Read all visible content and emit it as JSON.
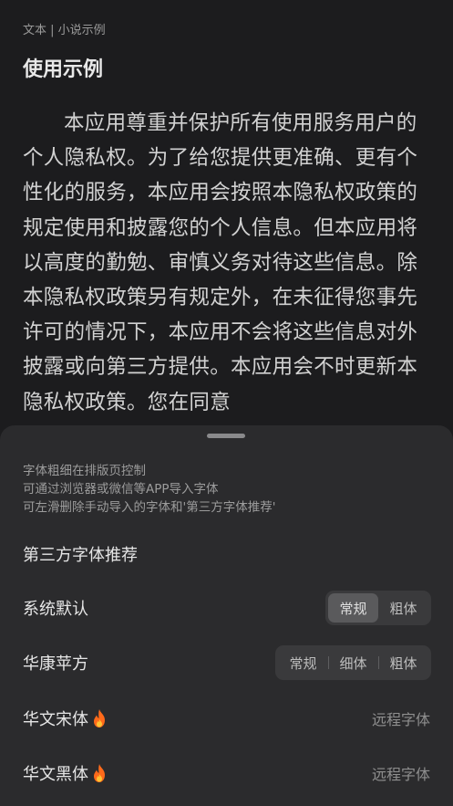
{
  "reader": {
    "breadcrumb": "文本 | 小说示例",
    "chapter_title": "使用示例",
    "body": "本应用尊重并保护所有使用服务用户的个人隐私权。为了给您提供更准确、更有个性化的服务，本应用会按照本隐私权政策的规定使用和披露您的个人信息。但本应用将以高度的勤勉、审慎义务对待这些信息。除本隐私权政策另有规定外，在未征得您事先许可的情况下，本应用不会将这些信息对外披露或向第三方提供。本应用会不时更新本隐私权政策。您在同意"
  },
  "font_sheet": {
    "hints": [
      "字体粗细在排版页控制",
      "可通过浏览器或微信等APP导入字体",
      "可左滑删除手动导入的字体和'第三方字体推荐'"
    ],
    "section_title": "第三方字体推荐",
    "fonts": [
      {
        "name": "系统默认",
        "weights": [
          "常规",
          "粗体"
        ],
        "selected": "常规"
      },
      {
        "name": "华康苹方",
        "weights": [
          "常规",
          "细体",
          "粗体"
        ],
        "selected": ""
      },
      {
        "name": "华文宋体",
        "icon": "fire-icon",
        "status": "远程字体"
      },
      {
        "name": "华文黑体",
        "icon": "fire-icon",
        "status": "远程字体"
      }
    ]
  },
  "colors": {
    "background": "#1c1c1e",
    "sheet": "#2b2b2d",
    "segment_bg": "#3a3a3c",
    "segment_active": "#5a5a5c",
    "fire": "#ff6a1a"
  }
}
